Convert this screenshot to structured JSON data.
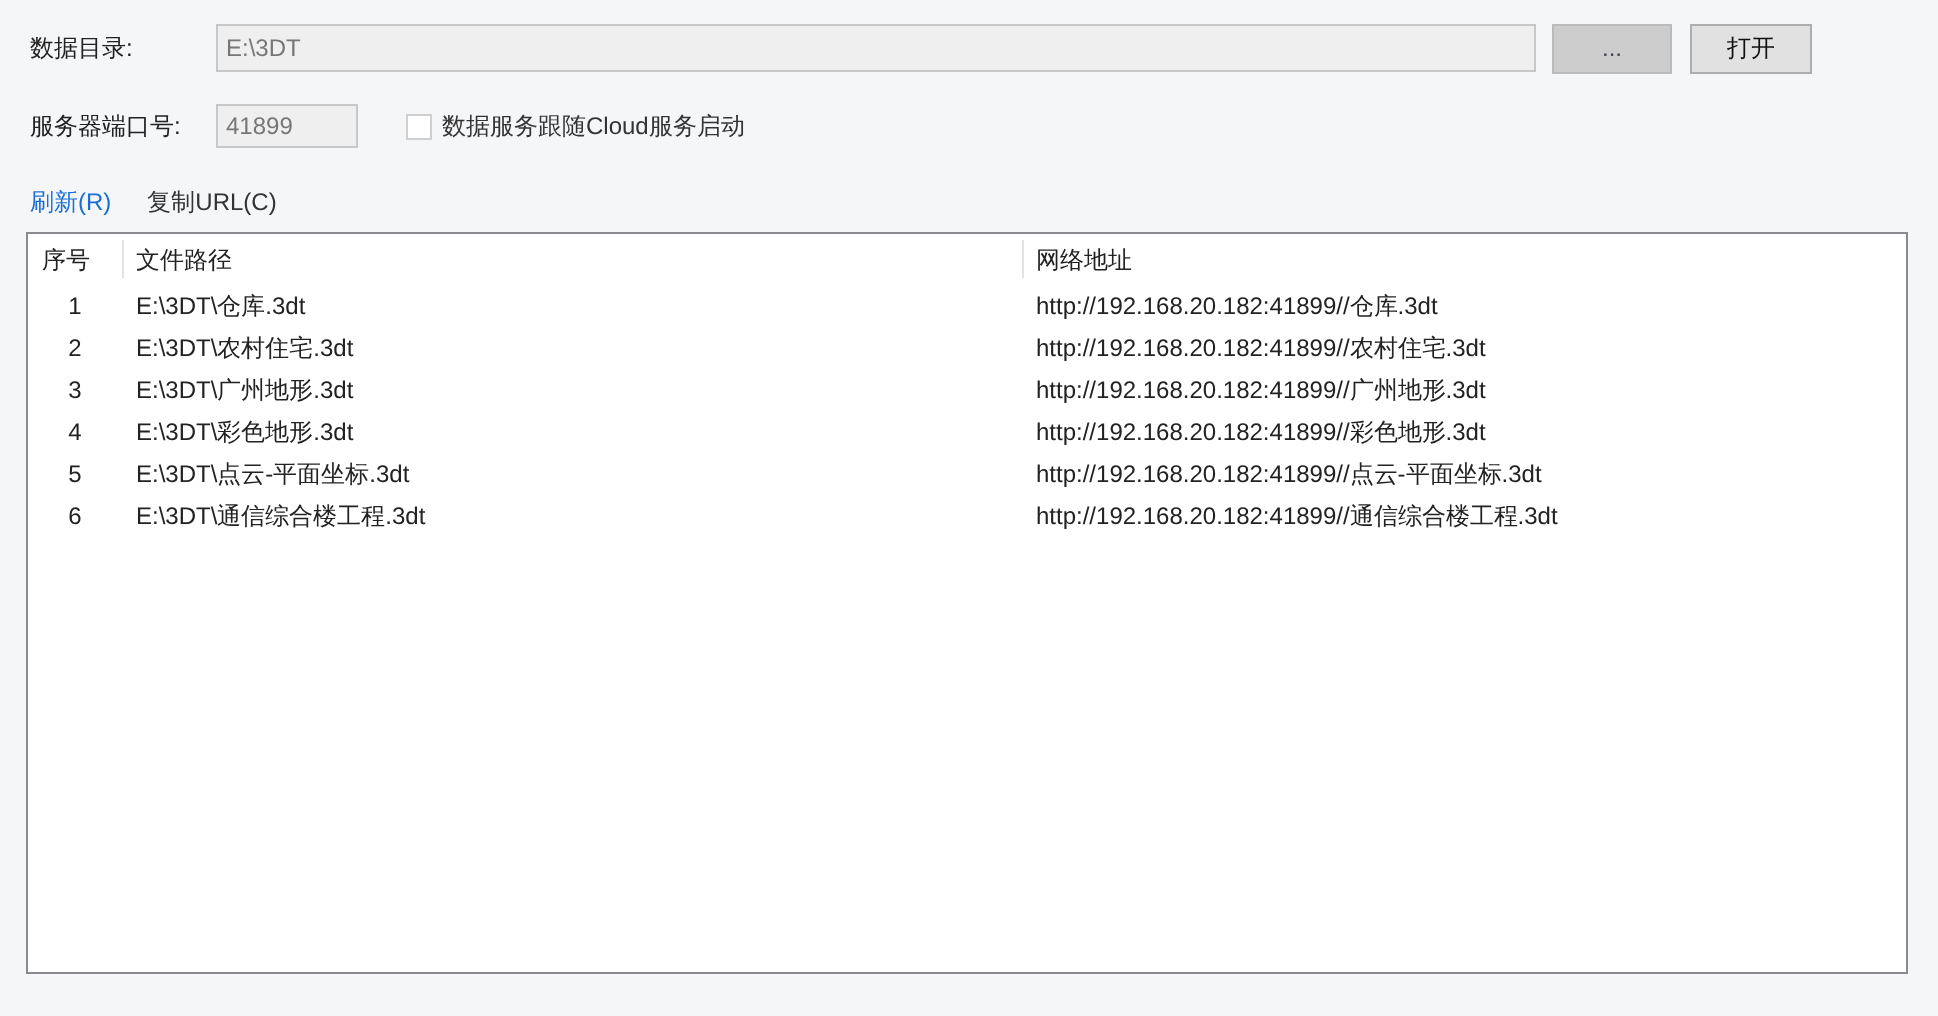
{
  "data_dir": {
    "label": "数据目录:",
    "value": "E:\\3DT"
  },
  "browse_button": "...",
  "open_button": "打开",
  "port": {
    "label": "服务器端口号:",
    "value": "41899"
  },
  "follow_cloud": {
    "label": "数据服务跟随Cloud服务启动",
    "checked": false
  },
  "links": [
    {
      "label": "刷新(R)",
      "kind": "primary"
    },
    {
      "label": "复制URL(C)",
      "kind": "plain"
    }
  ],
  "table": {
    "columns": [
      "序号",
      "文件路径",
      "网络地址"
    ],
    "rows": [
      [
        "1",
        "E:\\3DT\\仓库.3dt",
        "http://192.168.20.182:41899//仓库.3dt"
      ],
      [
        "2",
        "E:\\3DT\\农村住宅.3dt",
        "http://192.168.20.182:41899//农村住宅.3dt"
      ],
      [
        "3",
        "E:\\3DT\\广州地形.3dt",
        "http://192.168.20.182:41899//广州地形.3dt"
      ],
      [
        "4",
        "E:\\3DT\\彩色地形.3dt",
        "http://192.168.20.182:41899//彩色地形.3dt"
      ],
      [
        "5",
        "E:\\3DT\\点云-平面坐标.3dt",
        "http://192.168.20.182:41899//点云-平面坐标.3dt"
      ],
      [
        "6",
        "E:\\3DT\\通信综合楼工程.3dt",
        "http://192.168.20.182:41899//通信综合楼工程.3dt"
      ]
    ]
  }
}
